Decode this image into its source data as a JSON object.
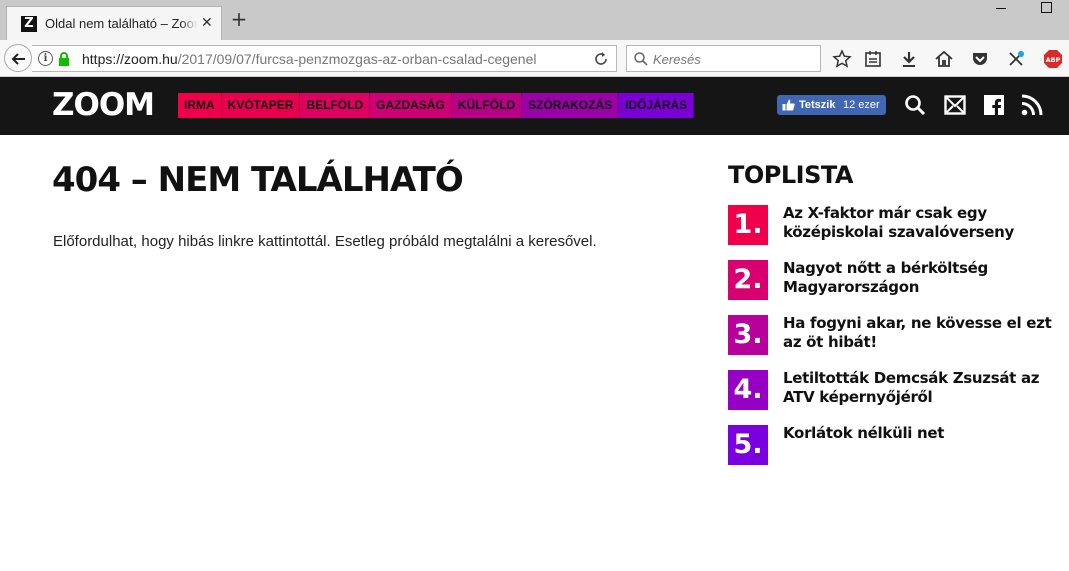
{
  "browser": {
    "tab_title": "Oldal nem található – Zoom",
    "tab_favicon": "Z",
    "url_host": "https://zoom.hu",
    "url_path": "/2017/09/07/furcsa-penzmozgas-az-orban-csalad-cegenel",
    "search_placeholder": "Keresés",
    "icons": [
      "back-icon",
      "info-icon",
      "lock-icon",
      "reload-icon",
      "search-icon",
      "star-icon",
      "reading-list-icon",
      "download-icon",
      "home-icon",
      "pocket-icon",
      "extension-icon",
      "adblock-icon"
    ]
  },
  "site": {
    "logo": "ZOOM",
    "menu": [
      {
        "label": "IRMA",
        "color": "#f0004a"
      },
      {
        "label": "KVÓTAPER",
        "color": "#e8004f"
      },
      {
        "label": "BELFÖLD",
        "color": "#dd0060"
      },
      {
        "label": "GAZDASÁG",
        "color": "#cc0072"
      },
      {
        "label": "KÜLFÖLD",
        "color": "#b80086"
      },
      {
        "label": "SZÓRAKOZÁS",
        "color": "#9a00a8"
      },
      {
        "label": "IDŐJÁRÁS",
        "color": "#7b00d6"
      }
    ],
    "facebook": {
      "label": "Tetszik",
      "count": "12 ezer"
    }
  },
  "main": {
    "title": "404 – NEM TALÁLHATÓ",
    "message": "Előfordulhat, hogy hibás linkre kattintottál. Esetleg próbáld megtalálni a keresővel."
  },
  "toplist": {
    "title": "TOPLISTA",
    "items": [
      {
        "rank": "1.",
        "text": "Az X-faktor már csak egy középiskolai szavalóverseny",
        "color": "#f0004a"
      },
      {
        "rank": "2.",
        "text": "Nagyot nőtt a bérköltség Magyarországon",
        "color": "#d80070"
      },
      {
        "rank": "3.",
        "text": "Ha fogyni akar, ne kövesse el ezt az öt hibát!",
        "color": "#b8009a"
      },
      {
        "rank": "4.",
        "text": "Letiltották Demcsák Zsuzsát az ATV képernyőjéről",
        "color": "#9600c4"
      },
      {
        "rank": "5.",
        "text": "Korlátok nélküli net",
        "color": "#7a00e0"
      }
    ]
  }
}
